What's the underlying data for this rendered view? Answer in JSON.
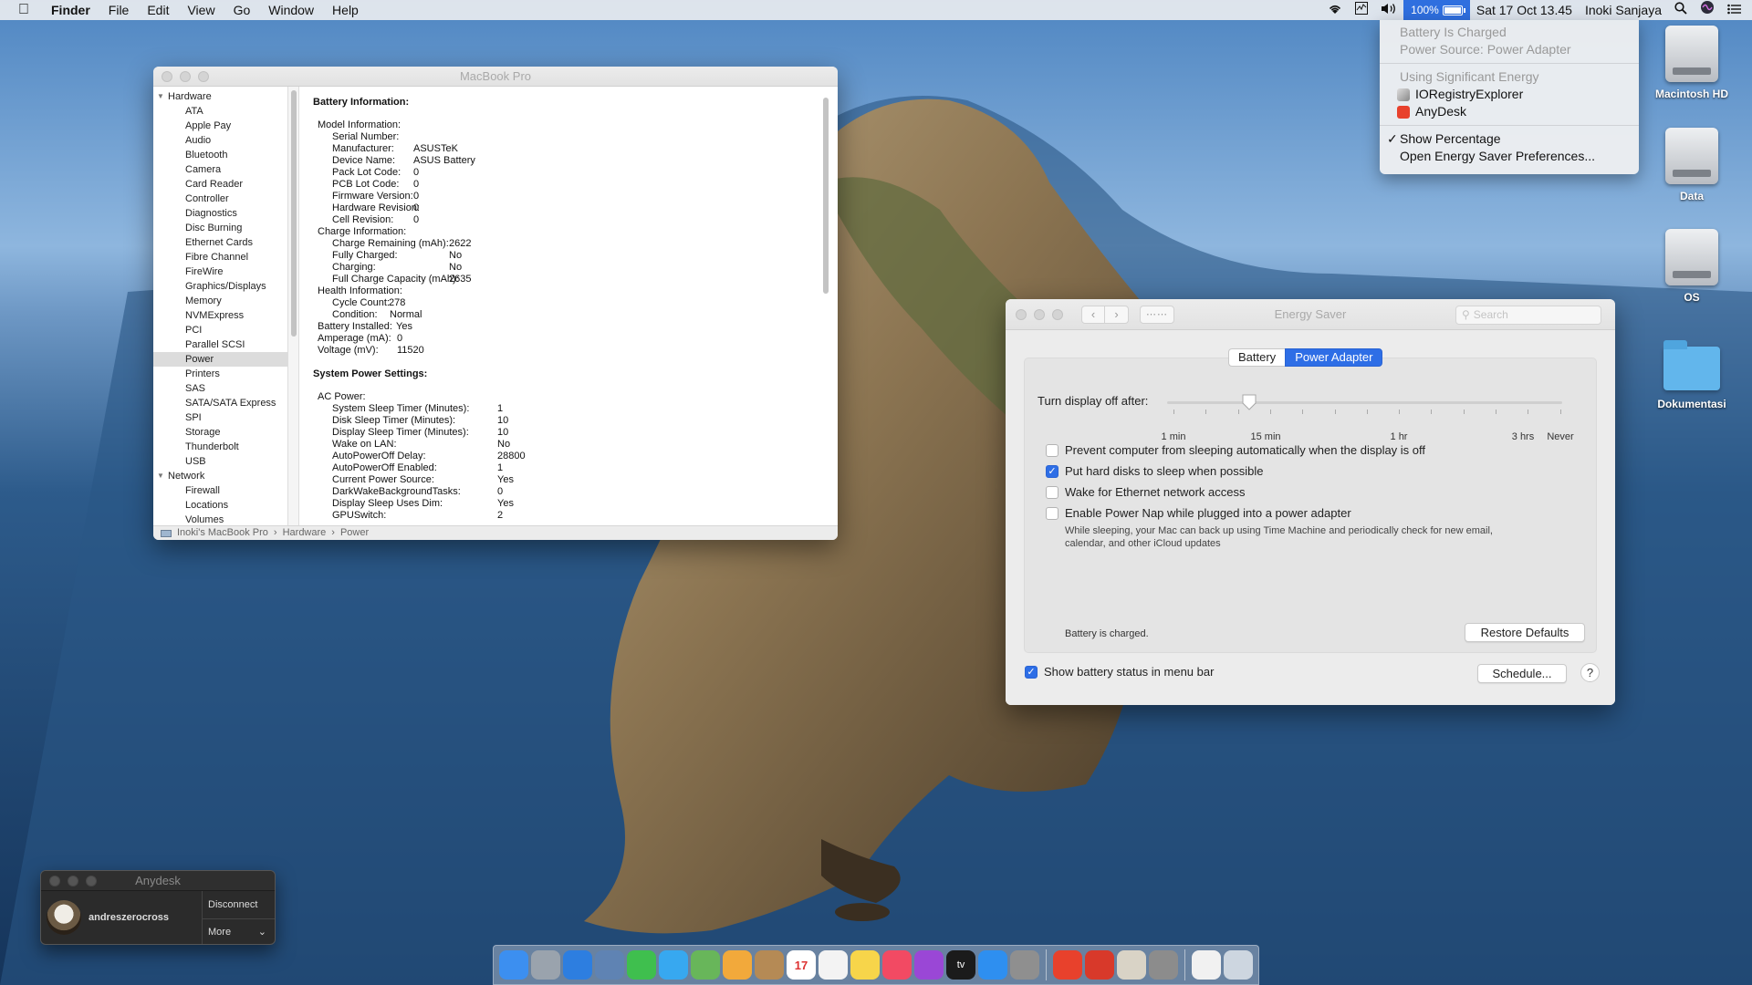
{
  "menubar": {
    "app_name": "Finder",
    "menus": [
      "File",
      "Edit",
      "View",
      "Go",
      "Window",
      "Help"
    ],
    "battery_percent": "100%",
    "datetime": "Sat 17 Oct  13.45",
    "user": "Inoki Sanjaya"
  },
  "battery_menu": {
    "status": "Battery Is Charged",
    "power_source": "Power Source: Power Adapter",
    "significant_header": "Using Significant Energy",
    "apps": [
      "IORegistryExplorer",
      "AnyDesk"
    ],
    "show_percentage": "Show Percentage",
    "open_prefs": "Open Energy Saver Preferences..."
  },
  "desktop_icons": [
    {
      "label": "Macintosh HD",
      "icon": "hard-drive-icon"
    },
    {
      "label": "Data",
      "icon": "hard-drive-icon"
    },
    {
      "label": "OS",
      "icon": "hard-drive-icon"
    },
    {
      "label": "Dokumentasi",
      "icon": "folder-icon"
    }
  ],
  "sysinfo": {
    "title": "MacBook Pro",
    "sidebar": {
      "hardware_label": "Hardware",
      "hardware_items": [
        "ATA",
        "Apple Pay",
        "Audio",
        "Bluetooth",
        "Camera",
        "Card Reader",
        "Controller",
        "Diagnostics",
        "Disc Burning",
        "Ethernet Cards",
        "Fibre Channel",
        "FireWire",
        "Graphics/Displays",
        "Memory",
        "NVMExpress",
        "PCI",
        "Parallel SCSI",
        "Power",
        "Printers",
        "SAS",
        "SATA/SATA Express",
        "SPI",
        "Storage",
        "Thunderbolt",
        "USB"
      ],
      "selected": "Power",
      "network_label": "Network",
      "network_items": [
        "Firewall",
        "Locations",
        "Volumes"
      ]
    },
    "battery_header": "Battery Information:",
    "battery_rows": [
      {
        "k": "Model Information:",
        "v": "",
        "indent": 1
      },
      {
        "k": "Serial Number:",
        "v": "",
        "indent": 2
      },
      {
        "k": "Manufacturer:",
        "v": "ASUSTeK",
        "indent": 2
      },
      {
        "k": "Device Name:",
        "v": "ASUS Battery",
        "indent": 2
      },
      {
        "k": "Pack Lot Code:",
        "v": "0",
        "indent": 2
      },
      {
        "k": "PCB Lot Code:",
        "v": "0",
        "indent": 2
      },
      {
        "k": "Firmware Version:",
        "v": "0",
        "indent": 2
      },
      {
        "k": "Hardware Revision:",
        "v": "0",
        "indent": 2
      },
      {
        "k": "Cell Revision:",
        "v": "0",
        "indent": 2
      },
      {
        "k": "Charge Information:",
        "v": "",
        "indent": 1
      },
      {
        "k": "Charge Remaining (mAh):",
        "v": "2622",
        "indent": 2
      },
      {
        "k": "Fully Charged:",
        "v": "No",
        "indent": 2
      },
      {
        "k": "Charging:",
        "v": "No",
        "indent": 2
      },
      {
        "k": "Full Charge Capacity (mAh):",
        "v": "2635",
        "indent": 2
      },
      {
        "k": "Health Information:",
        "v": "",
        "indent": 1
      },
      {
        "k": "Cycle Count:",
        "v": "278",
        "indent": 2
      },
      {
        "k": "Condition:",
        "v": "Normal",
        "indent": 2
      },
      {
        "k": "Battery Installed:",
        "v": "Yes",
        "indent": 1
      },
      {
        "k": "Amperage (mA):",
        "v": "0",
        "indent": 1
      },
      {
        "k": "Voltage (mV):",
        "v": "11520",
        "indent": 1
      }
    ],
    "power_header": "System Power Settings:",
    "power_rows": [
      {
        "k": "AC Power:",
        "v": "",
        "indent": 1
      },
      {
        "k": "System Sleep Timer (Minutes):",
        "v": "1",
        "indent": 2
      },
      {
        "k": "Disk Sleep Timer (Minutes):",
        "v": "10",
        "indent": 2
      },
      {
        "k": "Display Sleep Timer (Minutes):",
        "v": "10",
        "indent": 2
      },
      {
        "k": "Wake on LAN:",
        "v": "No",
        "indent": 2
      },
      {
        "k": "AutoPowerOff Delay:",
        "v": "28800",
        "indent": 2
      },
      {
        "k": "AutoPowerOff Enabled:",
        "v": "1",
        "indent": 2
      },
      {
        "k": "Current Power Source:",
        "v": "Yes",
        "indent": 2
      },
      {
        "k": "DarkWakeBackgroundTasks:",
        "v": "0",
        "indent": 2
      },
      {
        "k": "Display Sleep Uses Dim:",
        "v": "Yes",
        "indent": 2
      },
      {
        "k": "GPUSwitch:",
        "v": "2",
        "indent": 2
      }
    ],
    "breadcrumb": [
      "Inoki's MacBook Pro",
      "Hardware",
      "Power"
    ]
  },
  "energy": {
    "title": "Energy Saver",
    "search_placeholder": "Search",
    "tabs": [
      "Battery",
      "Power Adapter"
    ],
    "active_tab": "Power Adapter",
    "slider_label": "Turn display off after:",
    "slider_value": "15 min",
    "slider_ticks": [
      "1 min",
      "15 min",
      "1 hr",
      "3 hrs",
      "Never"
    ],
    "options": [
      {
        "label": "Prevent computer from sleeping automatically when the display is off",
        "checked": false
      },
      {
        "label": "Put hard disks to sleep when possible",
        "checked": true
      },
      {
        "label": "Wake for Ethernet network access",
        "checked": false
      },
      {
        "label": "Enable Power Nap while plugged into a power adapter",
        "checked": false
      }
    ],
    "power_nap_desc": "While sleeping, your Mac can back up using Time Machine and periodically check for new email, calendar, and other iCloud updates",
    "status": "Battery is charged.",
    "restore_btn": "Restore Defaults",
    "show_status_label": "Show battery status in menu bar",
    "show_status_checked": true,
    "schedule_btn": "Schedule...",
    "help": "?"
  },
  "anydesk": {
    "title": "Anydesk",
    "user": "andreszerocross",
    "disconnect": "Disconnect",
    "more": "More"
  },
  "dock": {
    "apps": [
      {
        "name": "finder-icon",
        "color": "#3c8ff0"
      },
      {
        "name": "launchpad-icon",
        "color": "#9aa3ad"
      },
      {
        "name": "safari-icon",
        "color": "#2d7ee0"
      },
      {
        "name": "preview-icon",
        "color": "#5f83b3"
      },
      {
        "name": "facetime-icon",
        "color": "#3fbf4e"
      },
      {
        "name": "messages-icon",
        "color": "#37a8f0"
      },
      {
        "name": "maps-icon",
        "color": "#68b65a"
      },
      {
        "name": "photos-icon",
        "color": "#f2a93b"
      },
      {
        "name": "contacts-icon",
        "color": "#b58a55"
      },
      {
        "name": "calendar-icon",
        "color": "#ffffff"
      },
      {
        "name": "reminders-icon",
        "color": "#f3f3f3"
      },
      {
        "name": "notes-icon",
        "color": "#f7d54a"
      },
      {
        "name": "music-icon",
        "color": "#f24a63"
      },
      {
        "name": "podcasts-icon",
        "color": "#9a47d6"
      },
      {
        "name": "tv-icon",
        "color": "#1b1b1b"
      },
      {
        "name": "app-store-icon",
        "color": "#2e8ff0"
      },
      {
        "name": "system-preferences-icon",
        "color": "#8f8f8f"
      }
    ],
    "apps2": [
      {
        "name": "anydesk-icon",
        "color": "#e8412c"
      },
      {
        "name": "anydesk-alt-icon",
        "color": "#d8392a"
      },
      {
        "name": "script-editor-icon",
        "color": "#d9d3c6"
      },
      {
        "name": "ioregistry-icon",
        "color": "#8c8c8c"
      }
    ],
    "calendar_day": "17",
    "calendar_month": "OCT"
  }
}
